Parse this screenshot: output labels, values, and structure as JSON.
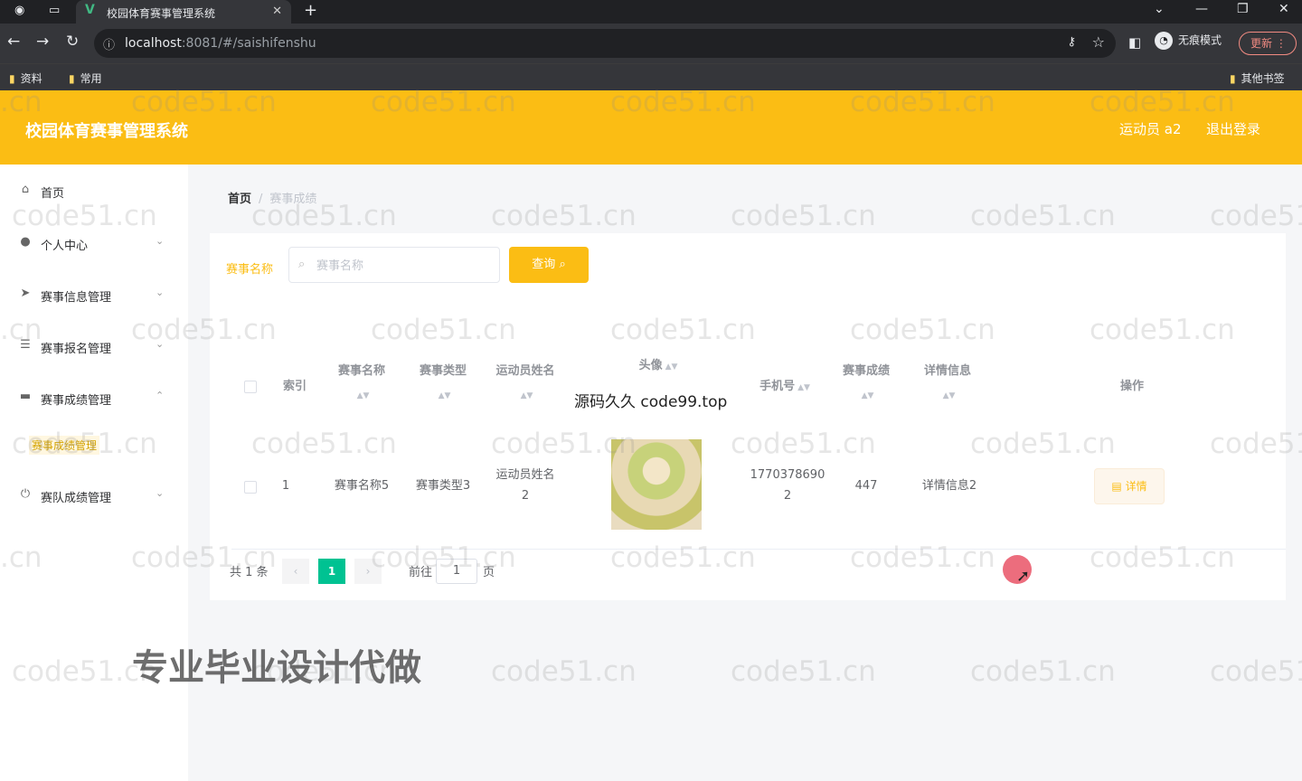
{
  "browser": {
    "tab_title": "校园体育赛事管理系统",
    "url_host": "localhost",
    "url_rest": ":8081/#/saishifenshu",
    "incognito_label": "无痕模式",
    "update_label": "更新",
    "bookmarks": [
      "资料",
      "常用"
    ],
    "other_bookmarks": "其他书签"
  },
  "header": {
    "title": "校园体育赛事管理系统",
    "user_label": "运动员 a2",
    "logout_label": "退出登录"
  },
  "sidebar": {
    "items": [
      {
        "label": "首页",
        "icon": "home-icon"
      },
      {
        "label": "个人中心",
        "icon": "user-icon"
      },
      {
        "label": "赛事信息管理",
        "icon": "send-icon"
      },
      {
        "label": "赛事报名管理",
        "icon": "list-icon"
      },
      {
        "label": "赛事成绩管理",
        "icon": "monitor-icon"
      },
      {
        "label": "赛队成绩管理",
        "icon": "power-icon"
      }
    ],
    "active_sub": "赛事成绩管理"
  },
  "breadcrumb": {
    "home": "首页",
    "current": "赛事成绩"
  },
  "search": {
    "label": "赛事名称",
    "placeholder": "赛事名称",
    "button": "查询"
  },
  "table": {
    "headers": [
      "索引",
      "赛事名称",
      "赛事类型",
      "运动员姓名",
      "头像",
      "手机号",
      "赛事成绩",
      "详情信息",
      "操作"
    ],
    "rows": [
      {
        "index": "1",
        "name": "赛事名称5",
        "type": "赛事类型3",
        "athlete": "运动员姓名2",
        "phone": "17703786902",
        "score": "447",
        "detail_info": "详情信息2",
        "action": "详情"
      }
    ]
  },
  "pagination": {
    "total": "共 1 条",
    "current_page": "1",
    "goto_label": "前往",
    "goto_value": "1",
    "page_suffix": "页"
  },
  "overlays": {
    "watermark": "code51.cn",
    "watermark_short": ".cn",
    "promo_top": "源码久久 code99.top",
    "promo_bottom": "专业毕业设计代做"
  },
  "colors": {
    "primary": "#fbbd14",
    "pager_active": "#00c292"
  }
}
